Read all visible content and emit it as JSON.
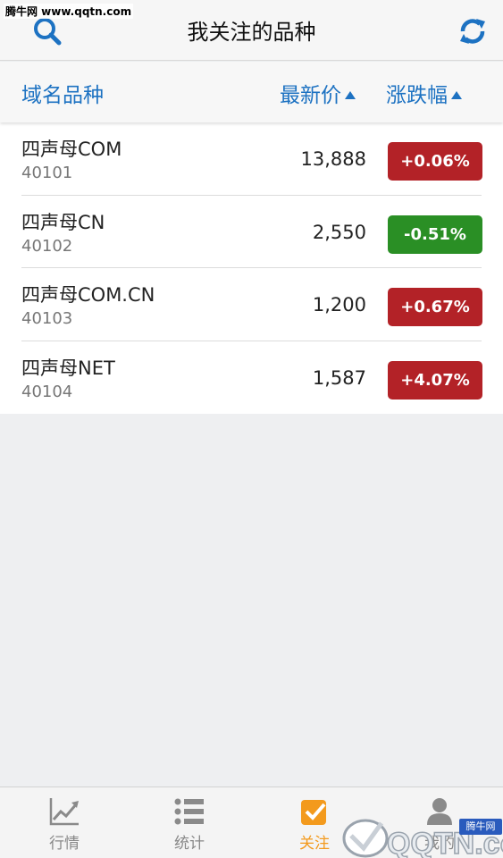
{
  "watermark": {
    "text": "腾牛网 www.qqtn.com"
  },
  "header": {
    "title": "我关注的品种",
    "left_icon": "search-icon",
    "right_icon": "refresh-icon"
  },
  "columns": {
    "name": "域名品种",
    "price": "最新价",
    "change": "涨跌幅"
  },
  "rows": [
    {
      "name": "四声母COM",
      "code": "40101",
      "price": "13,888",
      "change": "+0.06%",
      "color": "#b32227"
    },
    {
      "name": "四声母CN",
      "code": "40102",
      "price": "2,550",
      "change": "-0.51%",
      "color": "#2a8f25"
    },
    {
      "name": "四声母COM.CN",
      "code": "40103",
      "price": "1,200",
      "change": "+0.67%",
      "color": "#b32227"
    },
    {
      "name": "四声母NET",
      "code": "40104",
      "price": "1,587",
      "change": "+4.07%",
      "color": "#b32227"
    }
  ],
  "tabbar": {
    "tabs": [
      {
        "label": "行情",
        "icon": "trend-chart-icon"
      },
      {
        "label": "统计",
        "icon": "list-icon"
      },
      {
        "label": "关注",
        "icon": "checkbox-icon",
        "active": true
      },
      {
        "label": "我的",
        "icon": "user-icon"
      }
    ]
  },
  "brand": {
    "text": "QQTN.com",
    "mini": "腾牛网"
  },
  "colors": {
    "accent": "#1d72c2",
    "active_tab": "#f39a1d",
    "up": "#b32227",
    "down": "#2a8f25"
  }
}
